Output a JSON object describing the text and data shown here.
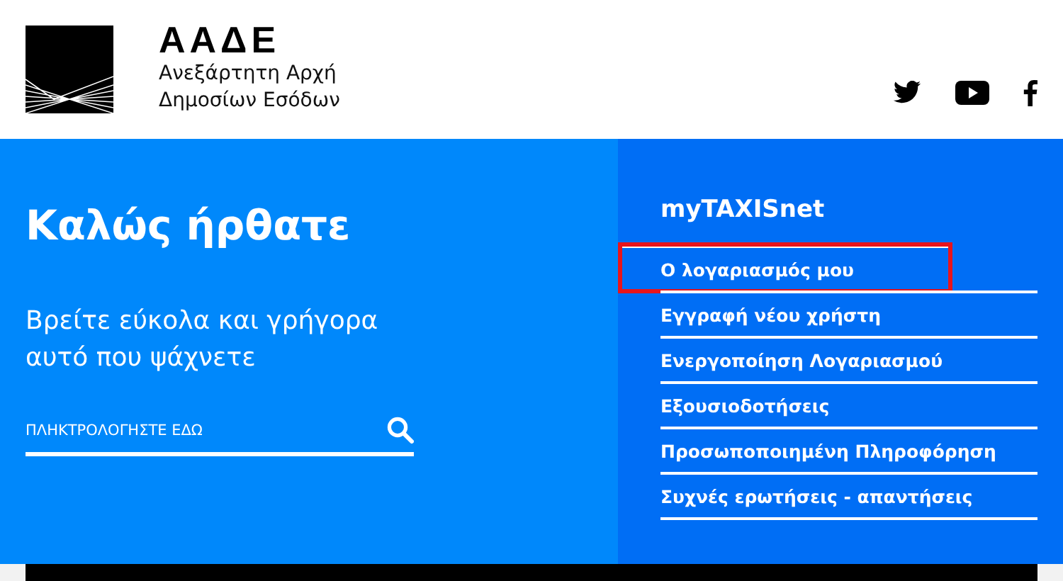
{
  "header": {
    "logo_title": "ΑΑΔΕ",
    "logo_subtitle_lines": [
      "Ανεξάρτητη Αρχή",
      "Δημοσίων Εσόδων"
    ],
    "social": [
      {
        "kind": "twitter"
      },
      {
        "kind": "youtube"
      },
      {
        "kind": "facebook"
      }
    ]
  },
  "hero": {
    "title": "Καλώς ήρθατε",
    "subtitle_lines": [
      "Βρείτε εύκολα και γρήγορα",
      "αυτό που ψάχνετε"
    ],
    "search": {
      "placeholder": "ΠΛΗΚΤΡΟΛΟΓΗΣΤΕ ΕΔΩ"
    }
  },
  "panel": {
    "title": "myTAXISnet",
    "links": [
      {
        "label": "Ο λογαριασμός μου",
        "highlighted": true
      },
      {
        "label": "Εγγραφή νέου χρήστη",
        "highlighted": false
      },
      {
        "label": "Ενεργοποίηση Λογαριασμού",
        "highlighted": false
      },
      {
        "label": "Εξουσιοδοτήσεις",
        "highlighted": false
      },
      {
        "label": "Προσωποποιημένη Πληροφόρηση",
        "highlighted": false
      },
      {
        "label": "Συχνές ερωτήσεις - απαντήσεις",
        "highlighted": false
      }
    ]
  }
}
